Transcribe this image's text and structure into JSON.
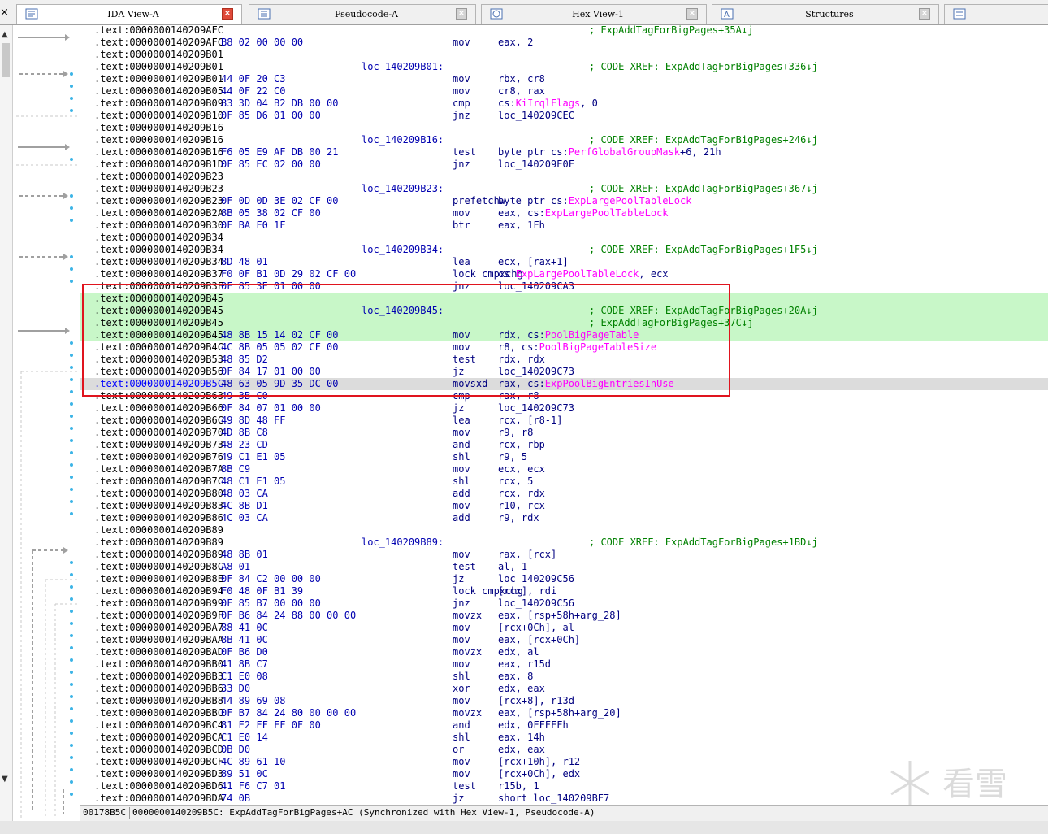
{
  "tabs": [
    {
      "label": "IDA View-A",
      "active": true,
      "icon": "ida-view-icon"
    },
    {
      "label": "Pseudocode-A",
      "active": false,
      "icon": "pseudocode-icon"
    },
    {
      "label": "Hex View-1",
      "active": false,
      "icon": "hex-view-icon"
    },
    {
      "label": "Structures",
      "active": false,
      "icon": "structures-icon"
    },
    {
      "label": "",
      "active": false,
      "icon": "enums-icon"
    }
  ],
  "listing": [
    {
      "a": ".text:0000000140209AFC",
      "b": "",
      "l": "",
      "m": "",
      "o": [],
      "c": "; ExpAddTagForBigPages+35A↓j"
    },
    {
      "a": ".text:0000000140209AFC",
      "b": "B8 02 00 00 00",
      "l": "",
      "m": "mov",
      "o": [
        [
          "eax, 2",
          0
        ]
      ],
      "c": ""
    },
    {
      "a": ".text:0000000140209B01",
      "b": "",
      "l": "",
      "m": "",
      "o": [],
      "c": ""
    },
    {
      "a": ".text:0000000140209B01",
      "b": "",
      "l": "loc_140209B01:",
      "m": "",
      "o": [],
      "c": "; CODE XREF: ExpAddTagForBigPages+336↓j"
    },
    {
      "a": ".text:0000000140209B01",
      "b": "44 0F 20 C3",
      "l": "",
      "m": "mov",
      "o": [
        [
          "rbx, cr8",
          0
        ]
      ],
      "c": ""
    },
    {
      "a": ".text:0000000140209B05",
      "b": "44 0F 22 C0",
      "l": "",
      "m": "mov",
      "o": [
        [
          "cr8, rax",
          0
        ]
      ],
      "c": ""
    },
    {
      "a": ".text:0000000140209B09",
      "b": "83 3D 04 B2 DB 00 00",
      "l": "",
      "m": "cmp",
      "o": [
        [
          "cs:",
          0
        ],
        [
          "KiIrqlFlags",
          1
        ],
        [
          ", 0",
          0
        ]
      ],
      "c": ""
    },
    {
      "a": ".text:0000000140209B10",
      "b": "0F 85 D6 01 00 00",
      "l": "",
      "m": "jnz",
      "o": [
        [
          "loc_140209CEC",
          0
        ]
      ],
      "c": ""
    },
    {
      "a": ".text:0000000140209B16",
      "b": "",
      "l": "",
      "m": "",
      "o": [],
      "c": ""
    },
    {
      "a": ".text:0000000140209B16",
      "b": "",
      "l": "loc_140209B16:",
      "m": "",
      "o": [],
      "c": "; CODE XREF: ExpAddTagForBigPages+246↓j"
    },
    {
      "a": ".text:0000000140209B16",
      "b": "F6 05 E9 AF DB 00 21",
      "l": "",
      "m": "test",
      "o": [
        [
          "byte ptr cs:",
          0
        ],
        [
          "PerfGlobalGroupMask",
          1
        ],
        [
          "+6, 21h",
          0
        ]
      ],
      "c": ""
    },
    {
      "a": ".text:0000000140209B1D",
      "b": "0F 85 EC 02 00 00",
      "l": "",
      "m": "jnz",
      "o": [
        [
          "loc_140209E0F",
          0
        ]
      ],
      "c": ""
    },
    {
      "a": ".text:0000000140209B23",
      "b": "",
      "l": "",
      "m": "",
      "o": [],
      "c": ""
    },
    {
      "a": ".text:0000000140209B23",
      "b": "",
      "l": "loc_140209B23:",
      "m": "",
      "o": [],
      "c": "; CODE XREF: ExpAddTagForBigPages+367↓j"
    },
    {
      "a": ".text:0000000140209B23",
      "b": "0F 0D 0D 3E 02 CF 00",
      "l": "",
      "m": "prefetchw",
      "o": [
        [
          "byte ptr cs:",
          0
        ],
        [
          "ExpLargePoolTableLock",
          1
        ]
      ],
      "c": ""
    },
    {
      "a": ".text:0000000140209B2A",
      "b": "8B 05 38 02 CF 00",
      "l": "",
      "m": "mov",
      "o": [
        [
          "eax, cs:",
          0
        ],
        [
          "ExpLargePoolTableLock",
          1
        ]
      ],
      "c": ""
    },
    {
      "a": ".text:0000000140209B30",
      "b": "0F BA F0 1F",
      "l": "",
      "m": "btr",
      "o": [
        [
          "eax, 1Fh",
          0
        ]
      ],
      "c": ""
    },
    {
      "a": ".text:0000000140209B34",
      "b": "",
      "l": "",
      "m": "",
      "o": [],
      "c": ""
    },
    {
      "a": ".text:0000000140209B34",
      "b": "",
      "l": "loc_140209B34:",
      "m": "",
      "o": [],
      "c": "; CODE XREF: ExpAddTagForBigPages+1F5↓j"
    },
    {
      "a": ".text:0000000140209B34",
      "b": "8D 48 01",
      "l": "",
      "m": "lea",
      "o": [
        [
          "ecx, [rax+1]",
          0
        ]
      ],
      "c": ""
    },
    {
      "a": ".text:0000000140209B37",
      "b": "F0 0F B1 0D 29 02 CF 00",
      "l": "",
      "m": "lock cmpxchg",
      "o": [
        [
          "cs:",
          0
        ],
        [
          "ExpLargePoolTableLock",
          1
        ],
        [
          ", ecx",
          0
        ]
      ],
      "c": ""
    },
    {
      "a": ".text:0000000140209B3F",
      "b": "0F 85 3E 01 00 00",
      "l": "",
      "m": "jnz",
      "o": [
        [
          "loc_140209CA3",
          0
        ]
      ],
      "c": ""
    },
    {
      "a": ".text:0000000140209B45",
      "b": "",
      "l": "",
      "m": "",
      "o": [],
      "c": "",
      "h": 1
    },
    {
      "a": ".text:0000000140209B45",
      "b": "",
      "l": "loc_140209B45:",
      "m": "",
      "o": [],
      "c": "; CODE XREF: ExpAddTagForBigPages+20A↓j",
      "h": 1
    },
    {
      "a": ".text:0000000140209B45",
      "b": "",
      "l": "",
      "m": "",
      "o": [],
      "c": "; ExpAddTagForBigPages+37C↓j",
      "h": 1
    },
    {
      "a": ".text:0000000140209B45",
      "b": "48 8B 15 14 02 CF 00",
      "l": "",
      "m": "mov",
      "o": [
        [
          "rdx, cs:",
          0
        ],
        [
          "PoolBigPageTable",
          1
        ]
      ],
      "c": "",
      "h": 1
    },
    {
      "a": ".text:0000000140209B4C",
      "b": "4C 8B 05 05 02 CF 00",
      "l": "",
      "m": "mov",
      "o": [
        [
          "r8, cs:",
          0
        ],
        [
          "PoolBigPageTableSize",
          1
        ]
      ],
      "c": ""
    },
    {
      "a": ".text:0000000140209B53",
      "b": "48 85 D2",
      "l": "",
      "m": "test",
      "o": [
        [
          "rdx, rdx",
          0
        ]
      ],
      "c": ""
    },
    {
      "a": ".text:0000000140209B56",
      "b": "0F 84 17 01 00 00",
      "l": "",
      "m": "jz",
      "o": [
        [
          "loc_140209C73",
          0
        ]
      ],
      "c": ""
    },
    {
      "a": ".text:0000000140209B5C",
      "b": "48 63 05 9D 35 DC 00",
      "l": "",
      "m": "movsxd",
      "o": [
        [
          "rax, cs:",
          0
        ],
        [
          "ExpPoolBigEntriesInUse",
          1
        ]
      ],
      "c": "",
      "cur": 1
    },
    {
      "a": ".text:0000000140209B63",
      "b": "49 3B C0",
      "l": "",
      "m": "cmp",
      "o": [
        [
          "rax, r8",
          0
        ]
      ],
      "c": ""
    },
    {
      "a": ".text:0000000140209B66",
      "b": "0F 84 07 01 00 00",
      "l": "",
      "m": "jz",
      "o": [
        [
          "loc_140209C73",
          0
        ]
      ],
      "c": ""
    },
    {
      "a": ".text:0000000140209B6C",
      "b": "49 8D 48 FF",
      "l": "",
      "m": "lea",
      "o": [
        [
          "rcx, [r8-1]",
          0
        ]
      ],
      "c": ""
    },
    {
      "a": ".text:0000000140209B70",
      "b": "4D 8B C8",
      "l": "",
      "m": "mov",
      "o": [
        [
          "r9, r8",
          0
        ]
      ],
      "c": ""
    },
    {
      "a": ".text:0000000140209B73",
      "b": "48 23 CD",
      "l": "",
      "m": "and",
      "o": [
        [
          "rcx, rbp",
          0
        ]
      ],
      "c": ""
    },
    {
      "a": ".text:0000000140209B76",
      "b": "49 C1 E1 05",
      "l": "",
      "m": "shl",
      "o": [
        [
          "r9, 5",
          0
        ]
      ],
      "c": ""
    },
    {
      "a": ".text:0000000140209B7A",
      "b": "8B C9",
      "l": "",
      "m": "mov",
      "o": [
        [
          "ecx, ecx",
          0
        ]
      ],
      "c": ""
    },
    {
      "a": ".text:0000000140209B7C",
      "b": "48 C1 E1 05",
      "l": "",
      "m": "shl",
      "o": [
        [
          "rcx, 5",
          0
        ]
      ],
      "c": ""
    },
    {
      "a": ".text:0000000140209B80",
      "b": "48 03 CA",
      "l": "",
      "m": "add",
      "o": [
        [
          "rcx, rdx",
          0
        ]
      ],
      "c": ""
    },
    {
      "a": ".text:0000000140209B83",
      "b": "4C 8B D1",
      "l": "",
      "m": "mov",
      "o": [
        [
          "r10, rcx",
          0
        ]
      ],
      "c": ""
    },
    {
      "a": ".text:0000000140209B86",
      "b": "4C 03 CA",
      "l": "",
      "m": "add",
      "o": [
        [
          "r9, rdx",
          0
        ]
      ],
      "c": ""
    },
    {
      "a": ".text:0000000140209B89",
      "b": "",
      "l": "",
      "m": "",
      "o": [],
      "c": ""
    },
    {
      "a": ".text:0000000140209B89",
      "b": "",
      "l": "loc_140209B89:",
      "m": "",
      "o": [],
      "c": "; CODE XREF: ExpAddTagForBigPages+1BD↓j"
    },
    {
      "a": ".text:0000000140209B89",
      "b": "48 8B 01",
      "l": "",
      "m": "mov",
      "o": [
        [
          "rax, [rcx]",
          0
        ]
      ],
      "c": ""
    },
    {
      "a": ".text:0000000140209B8C",
      "b": "A8 01",
      "l": "",
      "m": "test",
      "o": [
        [
          "al, 1",
          0
        ]
      ],
      "c": ""
    },
    {
      "a": ".text:0000000140209B8E",
      "b": "0F 84 C2 00 00 00",
      "l": "",
      "m": "jz",
      "o": [
        [
          "loc_140209C56",
          0
        ]
      ],
      "c": ""
    },
    {
      "a": ".text:0000000140209B94",
      "b": "F0 48 0F B1 39",
      "l": "",
      "m": "lock cmpxchg",
      "o": [
        [
          "[rcx], rdi",
          0
        ]
      ],
      "c": ""
    },
    {
      "a": ".text:0000000140209B99",
      "b": "0F 85 B7 00 00 00",
      "l": "",
      "m": "jnz",
      "o": [
        [
          "loc_140209C56",
          0
        ]
      ],
      "c": ""
    },
    {
      "a": ".text:0000000140209B9F",
      "b": "0F B6 84 24 88 00 00 00",
      "l": "",
      "m": "movzx",
      "o": [
        [
          "eax, [rsp+58h+arg_28]",
          0
        ]
      ],
      "c": ""
    },
    {
      "a": ".text:0000000140209BA7",
      "b": "88 41 0C",
      "l": "",
      "m": "mov",
      "o": [
        [
          "[rcx+0Ch], al",
          0
        ]
      ],
      "c": ""
    },
    {
      "a": ".text:0000000140209BAA",
      "b": "8B 41 0C",
      "l": "",
      "m": "mov",
      "o": [
        [
          "eax, [rcx+0Ch]",
          0
        ]
      ],
      "c": ""
    },
    {
      "a": ".text:0000000140209BAD",
      "b": "0F B6 D0",
      "l": "",
      "m": "movzx",
      "o": [
        [
          "edx, al",
          0
        ]
      ],
      "c": ""
    },
    {
      "a": ".text:0000000140209BB0",
      "b": "41 8B C7",
      "l": "",
      "m": "mov",
      "o": [
        [
          "eax, r15d",
          0
        ]
      ],
      "c": ""
    },
    {
      "a": ".text:0000000140209BB3",
      "b": "C1 E0 08",
      "l": "",
      "m": "shl",
      "o": [
        [
          "eax, 8",
          0
        ]
      ],
      "c": ""
    },
    {
      "a": ".text:0000000140209BB6",
      "b": "33 D0",
      "l": "",
      "m": "xor",
      "o": [
        [
          "edx, eax",
          0
        ]
      ],
      "c": ""
    },
    {
      "a": ".text:0000000140209BB8",
      "b": "44 89 69 08",
      "l": "",
      "m": "mov",
      "o": [
        [
          "[rcx+8], r13d",
          0
        ]
      ],
      "c": ""
    },
    {
      "a": ".text:0000000140209BBC",
      "b": "0F B7 84 24 80 00 00 00",
      "l": "",
      "m": "movzx",
      "o": [
        [
          "eax, [rsp+58h+arg_20]",
          0
        ]
      ],
      "c": ""
    },
    {
      "a": ".text:0000000140209BC4",
      "b": "81 E2 FF FF 0F 00",
      "l": "",
      "m": "and",
      "o": [
        [
          "edx, 0FFFFFh",
          0
        ]
      ],
      "c": ""
    },
    {
      "a": ".text:0000000140209BCA",
      "b": "C1 E0 14",
      "l": "",
      "m": "shl",
      "o": [
        [
          "eax, 14h",
          0
        ]
      ],
      "c": ""
    },
    {
      "a": ".text:0000000140209BCD",
      "b": "0B D0",
      "l": "",
      "m": "or",
      "o": [
        [
          "edx, eax",
          0
        ]
      ],
      "c": ""
    },
    {
      "a": ".text:0000000140209BCF",
      "b": "4C 89 61 10",
      "l": "",
      "m": "mov",
      "o": [
        [
          "[rcx+10h], r12",
          0
        ]
      ],
      "c": ""
    },
    {
      "a": ".text:0000000140209BD3",
      "b": "89 51 0C",
      "l": "",
      "m": "mov",
      "o": [
        [
          "[rcx+0Ch], edx",
          0
        ]
      ],
      "c": ""
    },
    {
      "a": ".text:0000000140209BD6",
      "b": "41 F6 C7 01",
      "l": "",
      "m": "test",
      "o": [
        [
          "r15b, 1",
          0
        ]
      ],
      "c": ""
    },
    {
      "a": ".text:0000000140209BDA",
      "b": "74 0B",
      "l": "",
      "m": "jz",
      "o": [
        [
          "short loc_140209BE7",
          0
        ]
      ],
      "c": ""
    }
  ],
  "status": {
    "offset": "00178B5C",
    "location": "0000000140209B5C: ExpAddTagForBigPages+AC (Synchronized with Hex View-1, Pseudocode-A)"
  },
  "watermark": "看雪",
  "colors": {
    "highlight": "#c8f7c8",
    "comment": "#008000",
    "instruction": "#000080",
    "annotation_box": "#e0141e"
  }
}
